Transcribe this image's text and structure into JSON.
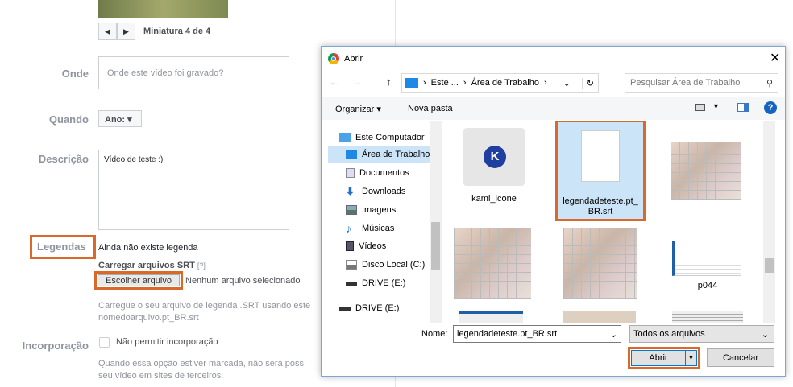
{
  "page": {
    "thumbnail_label": "Miniatura 4 de 4",
    "where": {
      "label": "Onde",
      "placeholder": "Onde este vídeo foi gravado?"
    },
    "when": {
      "label": "Quando",
      "select": "Ano:"
    },
    "description": {
      "label": "Descrição",
      "value": "Vídeo de teste :)"
    },
    "captions": {
      "label": "Legendas",
      "status": "Ainda não existe legenda",
      "upload_label": "Carregar arquivos SRT",
      "help": "[?]",
      "choose_button": "Escolher arquivo",
      "no_file": "Nenhum arquivo selecionado",
      "hint": "Carregue o seu arquivo de legenda .SRT usando este",
      "hint2": "nomedoarquivo.pt_BR.srt"
    },
    "embed": {
      "label": "Incorporação",
      "checkbox": "Não permitir incorporação",
      "hint": "Quando essa opção estiver marcada, não será possí",
      "hint2": "seu vídeo em sites de terceiros."
    }
  },
  "dialog": {
    "title": "Abrir",
    "breadcrumb": [
      "Este ...",
      "Área de Trabalho"
    ],
    "search_placeholder": "Pesquisar Área de Trabalho",
    "organize": "Organizar ▾",
    "new_folder": "Nova pasta",
    "nav": [
      "Este Computador",
      "Área de Trabalho",
      "Documentos",
      "Downloads",
      "Imagens",
      "Músicas",
      "Vídeos",
      "Disco Local (C:)",
      "DRIVE (E:)",
      "DRIVE (E:)"
    ],
    "files": [
      "kami_icone",
      "legendadeteste.pt_BR.srt",
      "p044"
    ],
    "filename_label": "Nome:",
    "filename_value": "legendadeteste.pt_BR.srt",
    "filter": "Todos os arquivos",
    "open_button": "Abrir",
    "cancel_button": "Cancelar"
  },
  "colors": {
    "highlight": "#d9692a",
    "selection": "#cce4f7"
  }
}
